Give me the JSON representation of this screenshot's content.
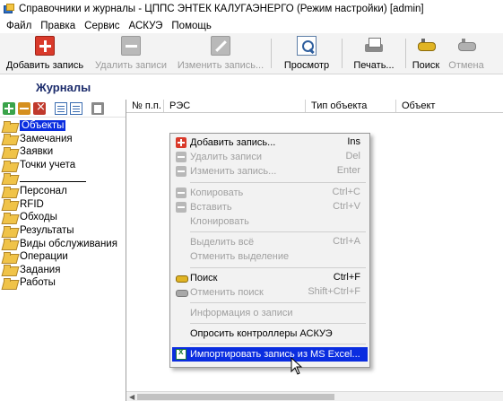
{
  "window": {
    "title": "Справочники и журналы - ЦППС ЭНТЕК КАЛУГАЭНЕРГО (Режим настройки) [admin]"
  },
  "menubar": [
    "Файл",
    "Правка",
    "Сервис",
    "АСКУЭ",
    "Помощь"
  ],
  "toolbar": {
    "add": "Добавить запись",
    "delete": "Удалить записи",
    "edit": "Изменить запись...",
    "view": "Просмотр",
    "print": "Печать...",
    "search": "Поиск",
    "cancel": "Отмена"
  },
  "journals": {
    "title": "Журналы"
  },
  "tree": {
    "items": [
      "Объекты",
      "Замечания",
      "Заявки",
      "Точки учета",
      "",
      "Персонал",
      "RFID",
      "Обходы",
      "Результаты",
      "Виды обслуживания",
      "Операции",
      "Задания",
      "Работы"
    ]
  },
  "grid": {
    "columns": [
      "№ п.п.",
      "РЭС",
      "Тип объекта",
      "Объект"
    ]
  },
  "context_menu": {
    "items": [
      {
        "label": "Добавить запись...",
        "shortcut": "Ins"
      },
      {
        "label": "Удалить записи",
        "shortcut": "Del"
      },
      {
        "label": "Изменить запись...",
        "shortcut": "Enter"
      },
      {
        "label": "Копировать",
        "shortcut": "Ctrl+C"
      },
      {
        "label": "Вставить",
        "shortcut": "Ctrl+V"
      },
      {
        "label": "Клонировать",
        "shortcut": ""
      },
      {
        "label": "Выделить всё",
        "shortcut": "Ctrl+A"
      },
      {
        "label": "Отменить выделение",
        "shortcut": ""
      },
      {
        "label": "Поиск",
        "shortcut": "Ctrl+F"
      },
      {
        "label": "Отменить поиск",
        "shortcut": "Shift+Ctrl+F"
      },
      {
        "label": "Информация о записи",
        "shortcut": ""
      },
      {
        "label": "Опросить контроллеры АСКУЭ",
        "shortcut": ""
      },
      {
        "label": "Импортировать запись из MS Excel...",
        "shortcut": ""
      }
    ]
  },
  "colors": {
    "selection": "#0a2de0",
    "journals_title": "#1c2c6c"
  }
}
